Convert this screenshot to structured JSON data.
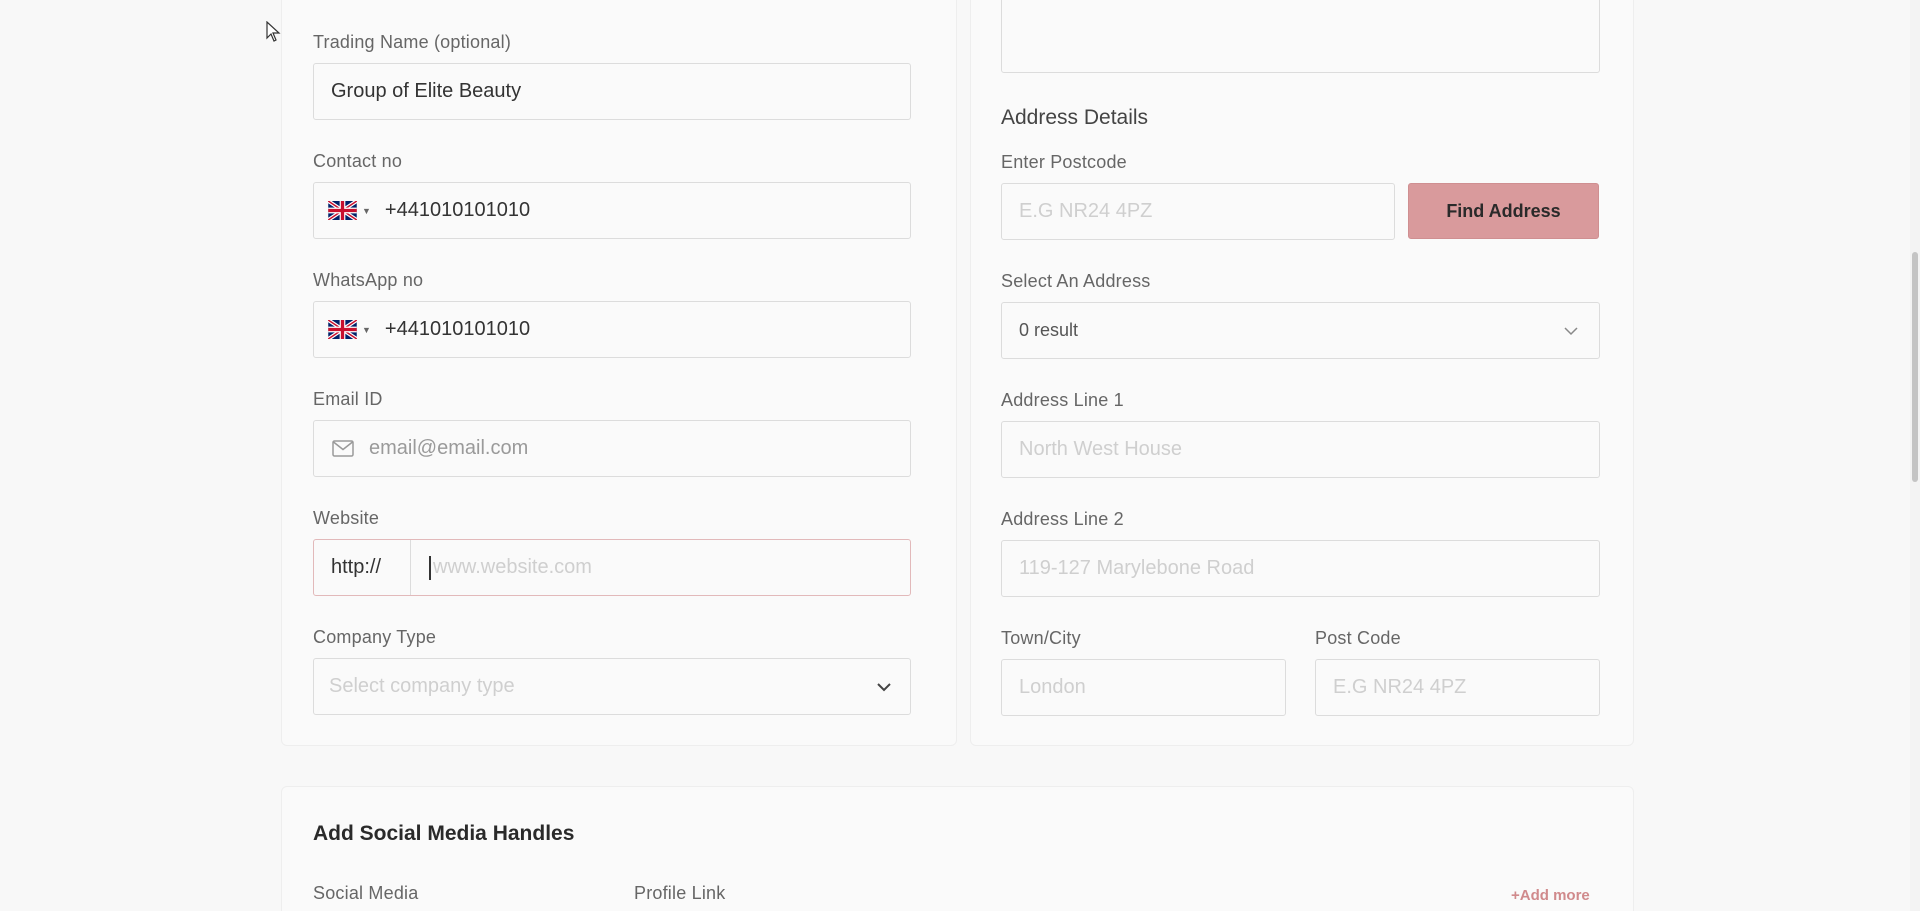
{
  "form": {
    "trading_name": {
      "label": "Trading Name (optional)",
      "value": "Group of Elite Beauty"
    },
    "contact_no": {
      "label": "Contact no",
      "value": "+441010101010"
    },
    "whatsapp_no": {
      "label": "WhatsApp no",
      "value": "+441010101010"
    },
    "email": {
      "label": "Email ID",
      "placeholder": "email@email.com"
    },
    "website": {
      "label": "Website",
      "prefix": "http://",
      "placeholder": "www.website.com"
    },
    "company_type": {
      "label": "Company Type",
      "placeholder": "Select company type"
    }
  },
  "address": {
    "heading": "Address Details",
    "postcode_search": {
      "label": "Enter Postcode",
      "placeholder": "E.G NR24 4PZ",
      "button_label": "Find Address"
    },
    "select_address": {
      "label": "Select An Address",
      "value": "0 result"
    },
    "line1": {
      "label": "Address Line 1",
      "placeholder": "North West House"
    },
    "line2": {
      "label": "Address Line 2",
      "placeholder": "119-127 Marylebone Road"
    },
    "town": {
      "label": "Town/City",
      "placeholder": "London"
    },
    "post_code": {
      "label": "Post Code",
      "placeholder": "E.G NR24 4PZ"
    }
  },
  "social": {
    "heading": "Add Social Media Handles",
    "col_social_media": "Social Media",
    "col_profile_link": "Profile Link",
    "add_more": "+Add more"
  },
  "icons": {
    "flag": "uk-flag-icon",
    "email": "envelope-icon",
    "dropdown": "chevron-down-icon",
    "cursor": "mouse-pointer-icon"
  },
  "colors": {
    "accent": "#d99a9c",
    "accent_text": "#d08a8c",
    "focus_border": "#e2b9ba"
  }
}
